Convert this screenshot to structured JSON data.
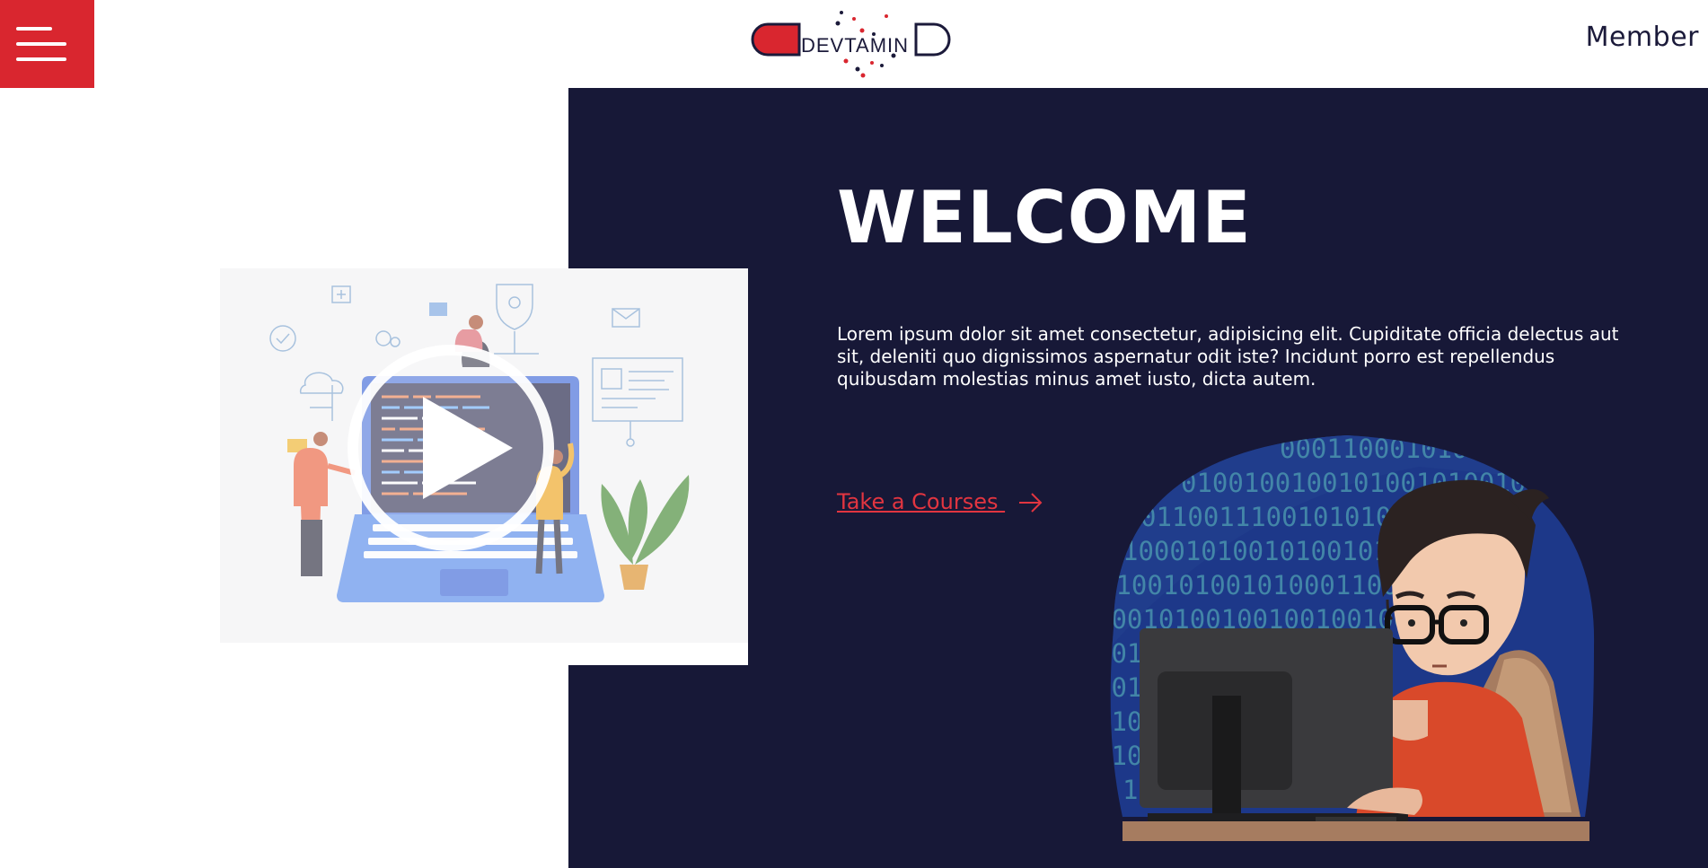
{
  "header": {
    "logo_text": "DEVTAMIN",
    "member_label": "Member"
  },
  "hero": {
    "title": "WELCOME",
    "description": "Lorem ipsum dolor sit amet consectetur, adipisicing elit. Cupiditate officia delectus aut sit, deleniti quo dignissimos aspernatur odit iste? Incidunt porro est repellendus quibusdam molestias minus amet iusto, dicta autem.",
    "cta_label": "Take a Courses ",
    "binary_rows": [
      "0001100010101",
      "0100100100101001010010",
      "01100111001010101011000",
      "1000101001010010101100",
      "0100101001010001100010",
      "10010100100100100100010",
      "001010100100100101",
      "1010010100100100101",
      "0100101001010010101",
      "0100101010010001",
      "10010100100100"
    ]
  },
  "icons": {
    "menu": "hamburger-menu-icon",
    "play": "play-icon",
    "arrow": "arrow-right-icon"
  },
  "colors": {
    "brand_red": "#d9262f",
    "navy": "#171837",
    "link_red": "#e23540",
    "text_dark": "#1b1a3a",
    "white": "#ffffff"
  }
}
